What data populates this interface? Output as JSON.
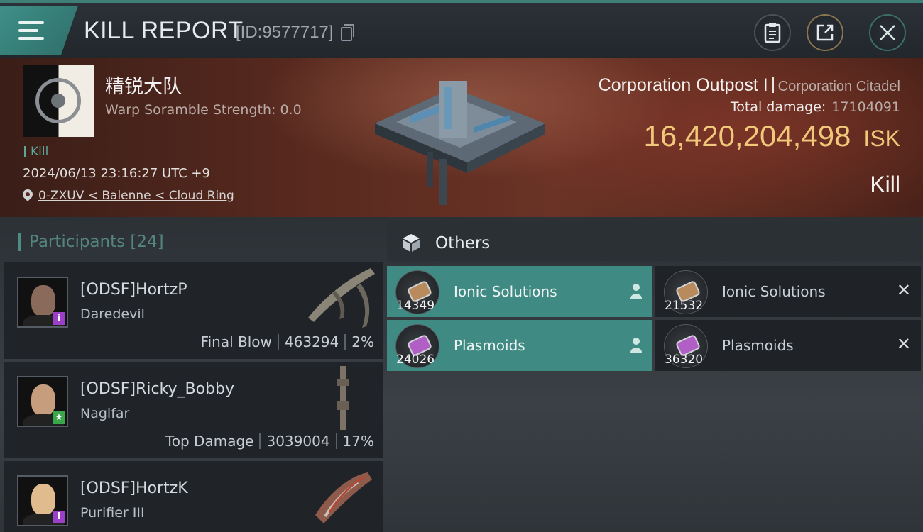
{
  "header": {
    "title": "KILL REPORT",
    "report_id": "[ID:9577717]"
  },
  "victim": {
    "corp_name": "精锐大队",
    "warp_scramble": "Warp Soramble Strength: 0.0",
    "tag": "Kill",
    "datetime": "2024/06/13 23:16:27 UTC +9",
    "location": "0-ZXUV < Balenne < Cloud Ring",
    "ship": "Corporation Outpost I",
    "ship_class": "Corporation Citadel",
    "total_damage_label": "Total damage:",
    "total_damage": "17104091",
    "isk_value": "16,420,204,498",
    "isk_unit": "ISK",
    "result": "Kill"
  },
  "participants": {
    "label": "Participants",
    "count": "[24]",
    "rows": [
      {
        "name": "[ODSF]HortzP",
        "ship": "Daredevil",
        "role": "Final Blow",
        "damage": "463294",
        "percent": "2%",
        "badge": "i"
      },
      {
        "name": "[ODSF]Ricky_Bobby",
        "ship": "Naglfar",
        "role": "Top Damage",
        "damage": "3039004",
        "percent": "17%",
        "badge": "★"
      },
      {
        "name": "[ODSF]HortzK",
        "ship": "Purifier III",
        "badge": "i"
      }
    ]
  },
  "others": {
    "title": "Others",
    "items": [
      {
        "name": "Ionic Solutions",
        "qty": "14349",
        "status": "dropped"
      },
      {
        "name": "Ionic Solutions",
        "qty": "21532",
        "status": "destroyed"
      },
      {
        "name": "Plasmoids",
        "qty": "24026",
        "status": "dropped"
      },
      {
        "name": "Plasmoids",
        "qty": "36320",
        "status": "destroyed"
      }
    ]
  },
  "colors": {
    "accent_teal": "#3f8b83",
    "isk_gold": "#f1c779",
    "banner_red": "#5a2a1f"
  },
  "icons": [
    "menu-icon",
    "copy-icon",
    "clipboard-icon",
    "share-icon",
    "close-icon",
    "location-pin-icon",
    "cube-icon",
    "person-icon",
    "x-icon"
  ]
}
